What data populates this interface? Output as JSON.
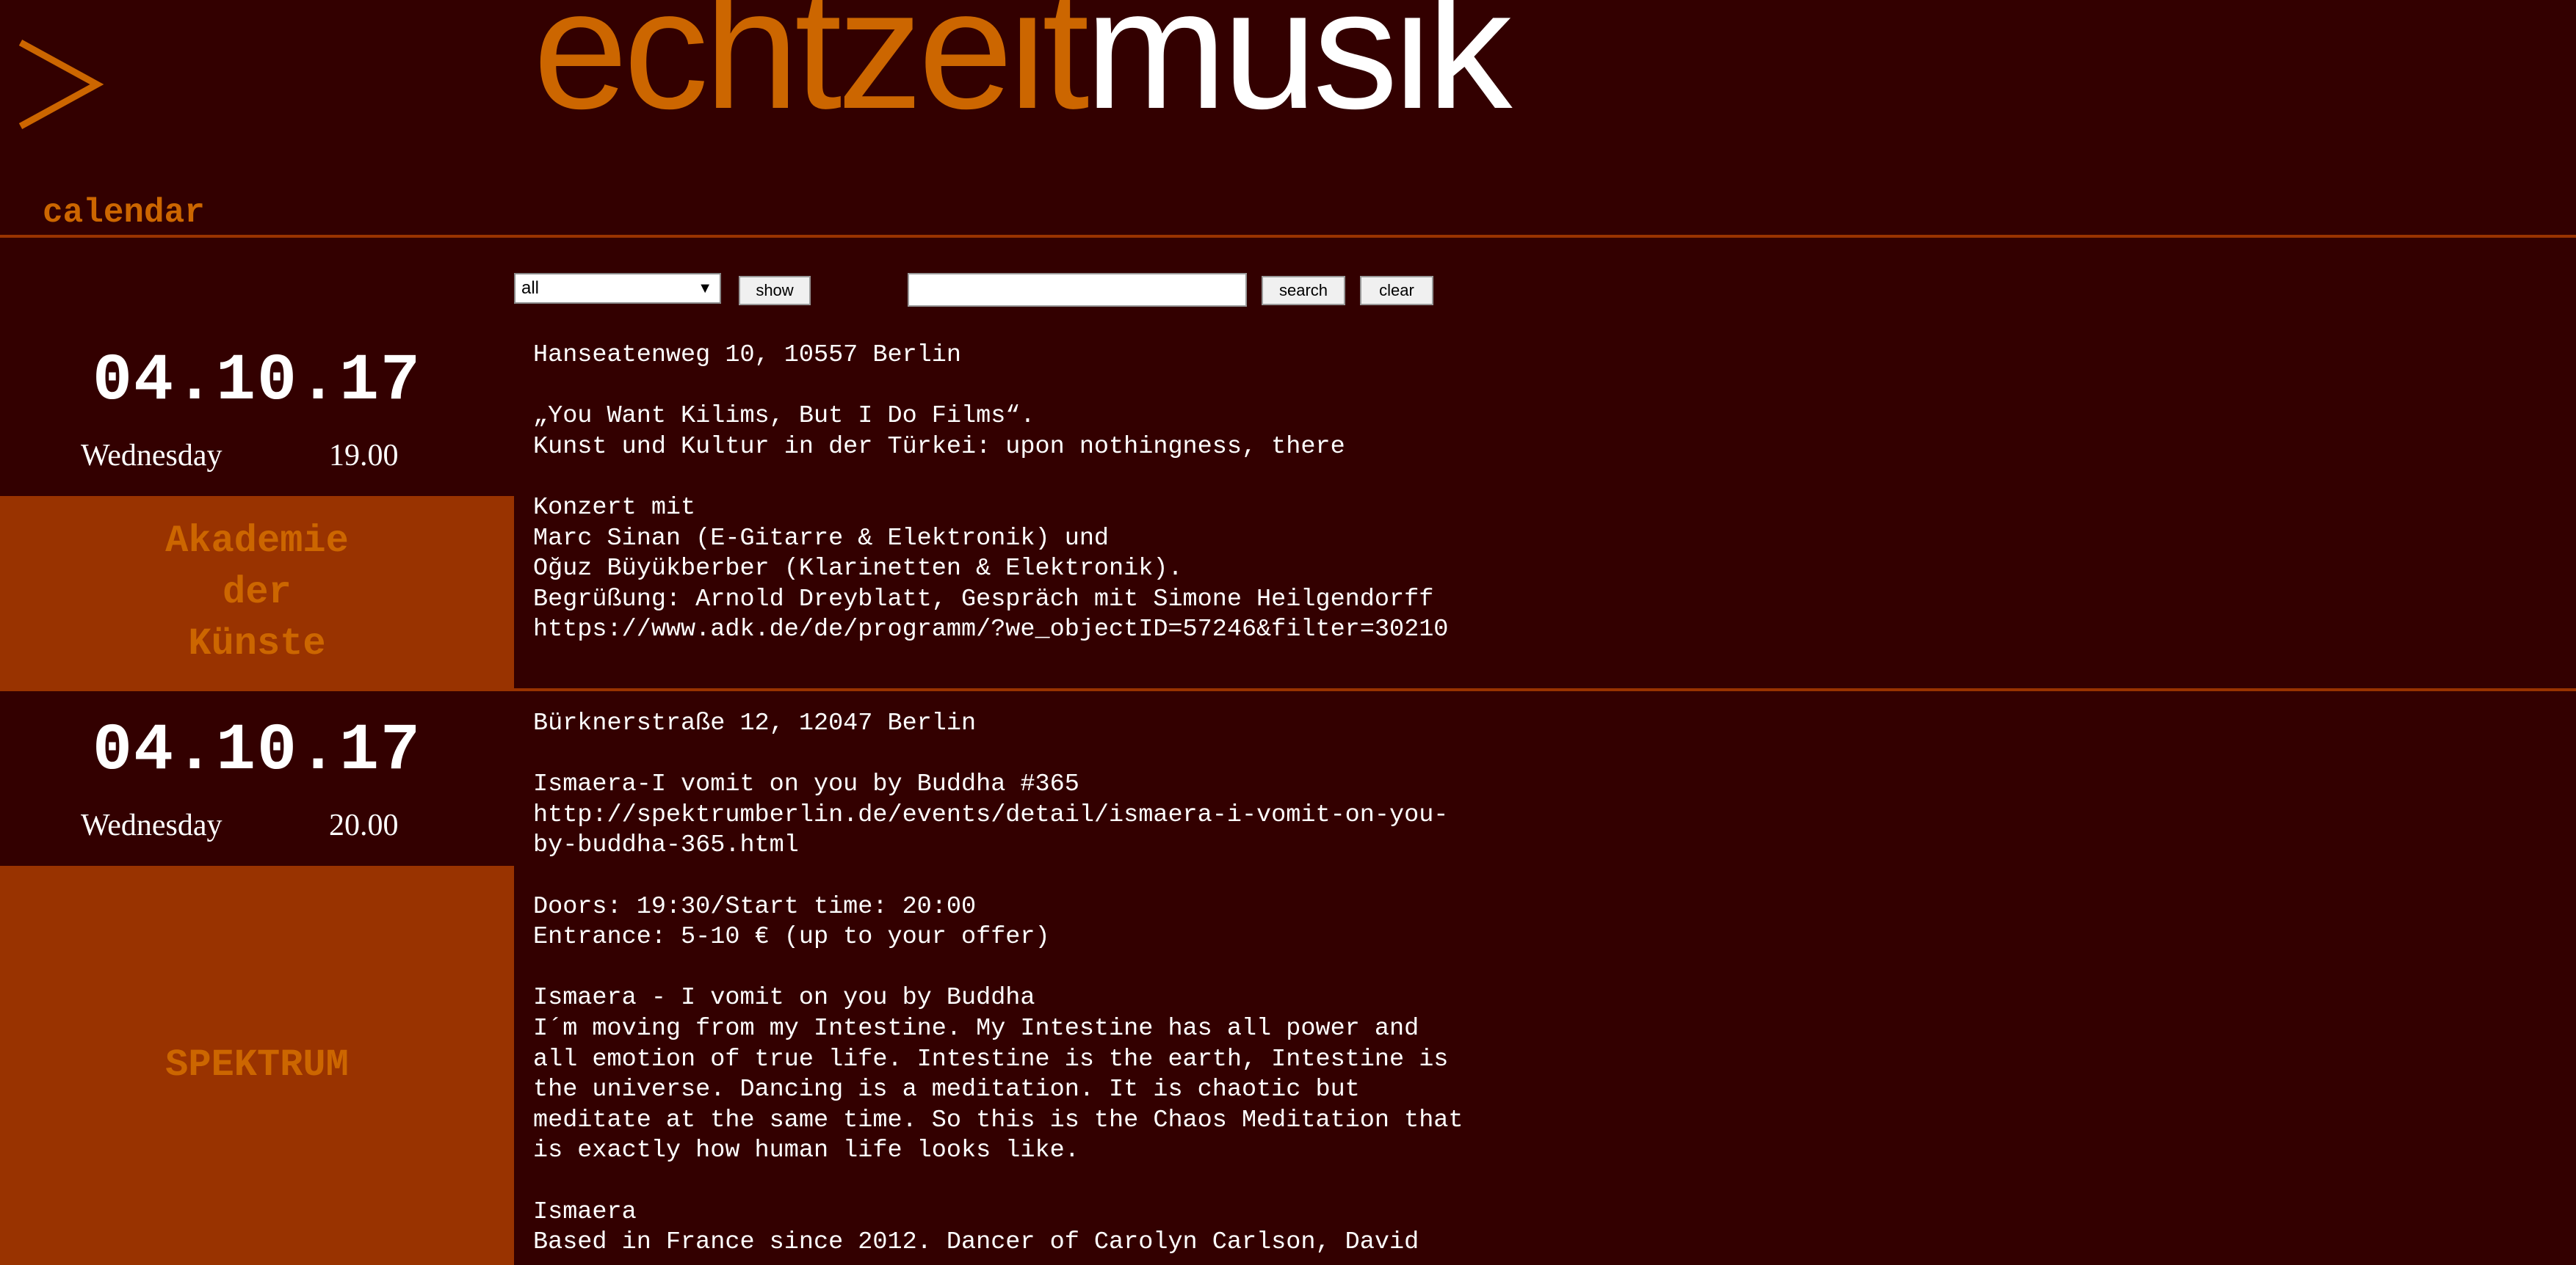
{
  "header": {
    "logo_glyph": ">",
    "brand_part1": "echtzeit",
    "brand_part2": "musik",
    "section_title": "calendar",
    "colors": {
      "background": "#330000",
      "accent": "#cc6600",
      "venue_bg": "#993300",
      "text": "#ffffff"
    }
  },
  "filter": {
    "category_selected": "all",
    "show_label": "show",
    "search_value": "",
    "search_label": "search",
    "clear_label": "clear"
  },
  "events": [
    {
      "date": "04.10.17",
      "weekday": "Wednesday",
      "time": "19.00",
      "venue": "Akademie\nder\nKünste",
      "lines": [
        "Hanseatenweg 10, 10557 Berlin",
        "",
        "„You Want Kilims, But I Do Films“.",
        "Kunst und Kultur in der Türkei: upon nothingness, there",
        "",
        "Konzert mit",
        "Marc Sinan (E-Gitarre & Elektronik) und",
        "Oğuz Büyükberber (Klarinetten & Elektronik).",
        "Begrüßung: Arnold Dreyblatt, Gespräch mit Simone Heilgendorff",
        "https://www.adk.de/de/programm/?we_objectID=57246&filter=30210"
      ]
    },
    {
      "date": "04.10.17",
      "weekday": "Wednesday",
      "time": "20.00",
      "venue": "SPEKTRUM",
      "lines": [
        "Bürknerstraße 12, 12047 Berlin",
        "",
        "Ismaera-I vomit on you by Buddha #365",
        "http://spektrumberlin.de/events/detail/ismaera-i-vomit-on-you-",
        "by-buddha-365.html",
        "",
        "Doors: 19:30/Start time: 20:00",
        "Entrance: 5-10 € (up to your offer)",
        "",
        "Ismaera - I vomit on you by Buddha",
        "I´m moving from my Intestine. My Intestine has all power and",
        "all emotion of true life. Intestine is the earth, Intestine is",
        "the universe. Dancing is a meditation. It is chaotic but",
        "meditate at the same time. So this is the Chaos Meditation that",
        "is exactly how human life looks like.",
        "",
        "Ismaera",
        "Based in France since 2012. Dancer of Carolyn Carlson, David"
      ]
    }
  ]
}
